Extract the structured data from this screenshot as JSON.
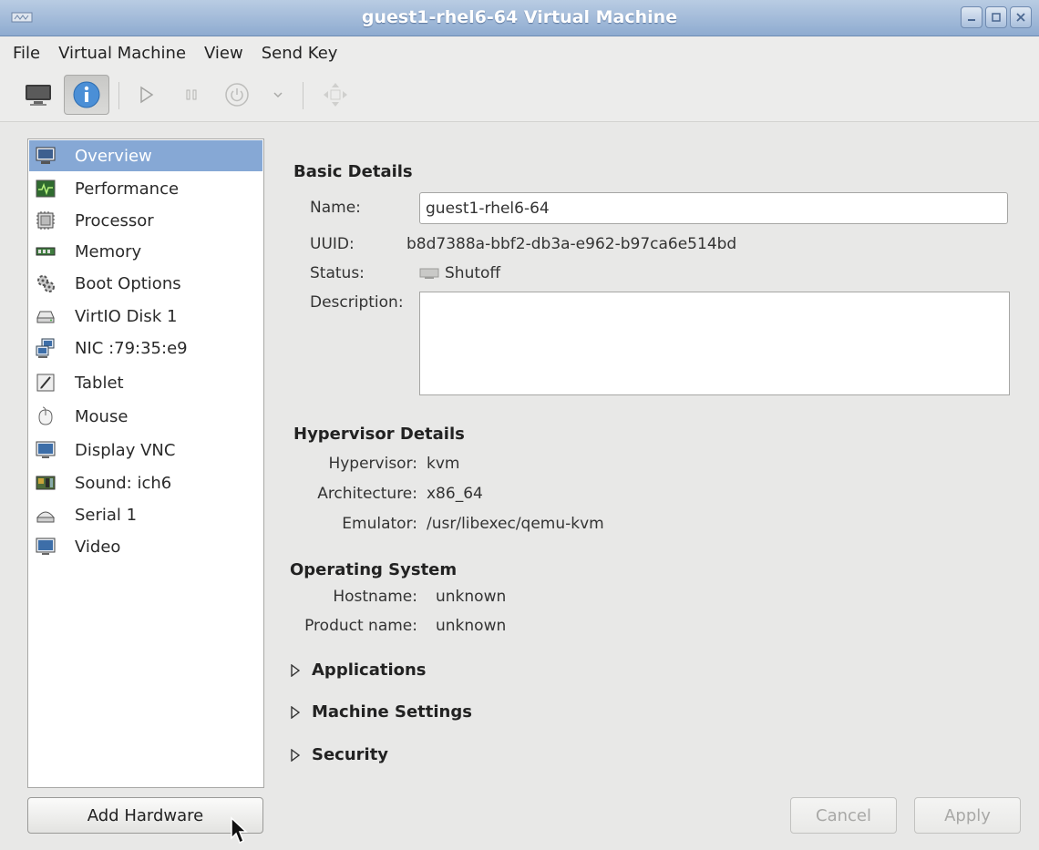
{
  "window": {
    "title": "guest1-rhel6-64 Virtual Machine"
  },
  "menu": [
    "File",
    "Virtual Machine",
    "View",
    "Send Key"
  ],
  "toolbar": {
    "buttons": [
      "console-icon",
      "info-icon",
      "run-icon",
      "pause-icon",
      "power-icon",
      "dropdown-arrow-icon",
      "fullscreen-icon"
    ],
    "pressed": "info-icon"
  },
  "hardware_list": [
    {
      "label": "Overview",
      "icon": "monitor-icon",
      "selected": true
    },
    {
      "label": "Performance",
      "icon": "performance-icon"
    },
    {
      "label": "Processor",
      "icon": "processor-icon"
    },
    {
      "label": "Memory",
      "icon": "memory-icon"
    },
    {
      "label": "Boot Options",
      "icon": "gears-icon"
    },
    {
      "label": "VirtIO Disk 1",
      "icon": "disk-icon"
    },
    {
      "label": "NIC :79:35:e9",
      "icon": "network-icon"
    },
    {
      "label": "Tablet",
      "icon": "tablet-icon"
    },
    {
      "label": "Mouse",
      "icon": "mouse-icon"
    },
    {
      "label": "Display VNC",
      "icon": "display-icon"
    },
    {
      "label": "Sound: ich6",
      "icon": "sound-card-icon"
    },
    {
      "label": "Serial 1",
      "icon": "serial-icon"
    },
    {
      "label": "Video",
      "icon": "video-icon"
    }
  ],
  "basic_details": {
    "title": "Basic Details",
    "name_label": "Name:",
    "name_value": "guest1-rhel6-64",
    "uuid_label": "UUID:",
    "uuid_value": "b8d7388a-bbf2-db3a-e962-b97ca6e514bd",
    "status_label": "Status:",
    "status_value": "Shutoff",
    "description_label": "Description:",
    "description_value": ""
  },
  "hypervisor_details": {
    "title": "Hypervisor Details",
    "hypervisor_label": "Hypervisor:",
    "hypervisor_value": "kvm",
    "architecture_label": "Architecture:",
    "architecture_value": "x86_64",
    "emulator_label": "Emulator:",
    "emulator_value": "/usr/libexec/qemu-kvm"
  },
  "operating_system": {
    "title": "Operating System",
    "hostname_label": "Hostname:",
    "hostname_value": "unknown",
    "product_label": "Product name:",
    "product_value": "unknown"
  },
  "expanders": [
    "Applications",
    "Machine Settings",
    "Security"
  ],
  "buttons": {
    "add_hardware": "Add Hardware",
    "cancel": "Cancel",
    "apply": "Apply"
  },
  "colors": {
    "selection": "#86a8d5",
    "titlebar": "#9fb8d9"
  }
}
